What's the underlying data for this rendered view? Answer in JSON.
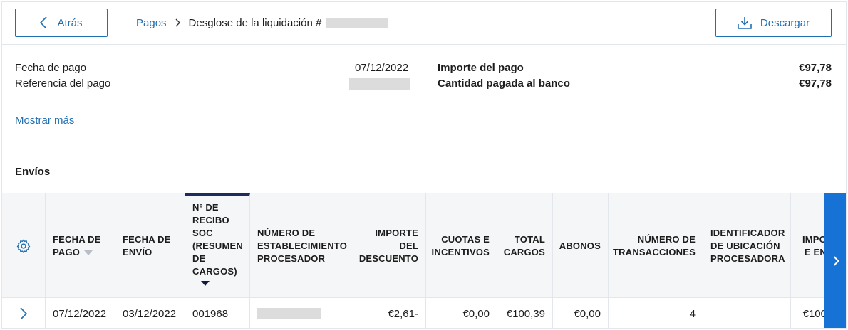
{
  "topbar": {
    "back_label": "Atrás",
    "download_label": "Descargar",
    "breadcrumb": {
      "link": "Pagos",
      "current": "Desglose de la liquidación #"
    }
  },
  "summary": {
    "payment_date_label": "Fecha de pago",
    "payment_date_value": "07/12/2022",
    "payment_ref_label": "Referencia del pago",
    "payment_amount_label": "Importe del pago",
    "payment_amount_value": "€97,78",
    "bank_paid_label": "Cantidad pagada al banco",
    "bank_paid_value": "€97,78",
    "show_more": "Mostrar más"
  },
  "section_title": "Envíos",
  "table": {
    "headers": {
      "payment_date": "Fecha de pago",
      "send_date": "Fecha de envío",
      "receipt_no": "Nº de recibo SOC (resumen de cargos)",
      "processor_no": "Número de establecimiento procesador",
      "discount": "Importe del descuento",
      "fees": "Cuotas e incentivos",
      "total_charges": "Total cargos",
      "credits": "Abonos",
      "tx_count": "Número de transacciones",
      "location_id": "Identificador de ubicación procesadora",
      "next": "Impo e en"
    },
    "row": {
      "payment_date": "07/12/2022",
      "send_date": "03/12/2022",
      "receipt_no": "001968",
      "discount": "€2,61-",
      "fees": "€0,00",
      "total_charges": "€100,39",
      "credits": "€0,00",
      "tx_count": "4",
      "next": "€100"
    }
  },
  "colors": {
    "accent": "#1f6fb2",
    "scroll_button": "#1672d4",
    "active_sort": "#1d2b5e"
  }
}
